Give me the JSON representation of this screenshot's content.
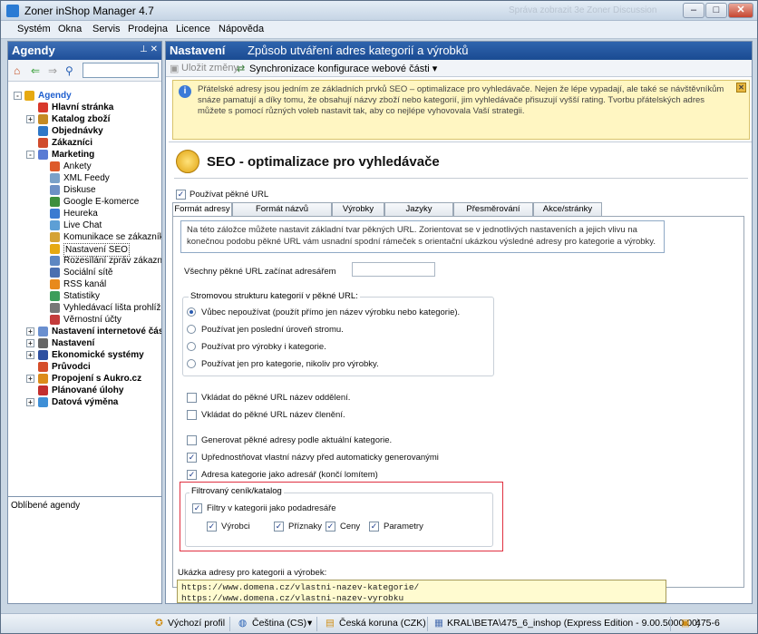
{
  "window": {
    "title": "Zoner inShop Manager 4.7",
    "ghost_text": "Správa zobrazit 3e Zoner Discussion"
  },
  "menu": [
    "Systém",
    "Okna",
    "Servis",
    "Prodejna",
    "Licence",
    "Nápověda"
  ],
  "left_panel": {
    "title": "Agendy",
    "pin_glyphs": "⊥ ✕",
    "search_placeholder": "",
    "tree": [
      {
        "label": "Agendy",
        "bold": true,
        "color": "#1f5fcf",
        "icon_color": "#e6a912",
        "exp": "-"
      },
      {
        "label": "Hlavní stránka",
        "bold": true,
        "icon": "home-icon",
        "icon_color": "#d8382b"
      },
      {
        "label": "Katalog zboží",
        "bold": true,
        "icon_color": "#c58a22",
        "exp": "+"
      },
      {
        "label": "Objednávky",
        "bold": true,
        "icon_color": "#2e77c7"
      },
      {
        "label": "Zákazníci",
        "bold": true,
        "icon_color": "#d04b2c"
      },
      {
        "label": "Marketing",
        "bold": true,
        "icon_color": "#5a7bd4",
        "exp": "-"
      },
      {
        "label": "Ankety",
        "icon_color": "#dd5a2b"
      },
      {
        "label": "XML Feedy",
        "icon_color": "#7aa1c9"
      },
      {
        "label": "Diskuse",
        "icon_color": "#6d90c5"
      },
      {
        "label": "Google E-komerce",
        "icon_color": "#3d8f3d"
      },
      {
        "label": "Heureka",
        "icon_color": "#3b7bd1"
      },
      {
        "label": "Live Chat",
        "icon_color": "#5d9fd5"
      },
      {
        "label": "Komunikace se zákazníkem",
        "icon_color": "#d5a335"
      },
      {
        "label": "Nastavení SEO",
        "icon_color": "#e6a912",
        "selected": true
      },
      {
        "label": "Rozesílání zpráv zákazníkům",
        "icon_color": "#5d87c2"
      },
      {
        "label": "Sociální sítě",
        "icon_color": "#4a6fb0"
      },
      {
        "label": "RSS kanál",
        "icon_color": "#e88a1c"
      },
      {
        "label": "Statistiky",
        "icon_color": "#3c9e5b"
      },
      {
        "label": "Vyhledávací lišta prohlížeče",
        "icon_color": "#777777"
      },
      {
        "label": "Věrnostní účty",
        "icon_color": "#c43c3c"
      },
      {
        "label": "Nastavení internetové části",
        "bold": true,
        "icon_color": "#6a8fcf",
        "exp": "+"
      },
      {
        "label": "Nastavení",
        "bold": true,
        "icon_color": "#666666",
        "exp": "+"
      },
      {
        "label": "Ekonomické systémy",
        "bold": true,
        "icon_color": "#2d4fa0",
        "exp": "+"
      },
      {
        "label": "Průvodci",
        "bold": true,
        "icon_color": "#d54d2a"
      },
      {
        "label": "Propojení s Aukro.cz",
        "bold": true,
        "icon_color": "#dc8c1a",
        "exp": "+"
      },
      {
        "label": "Plánované úlohy",
        "bold": true,
        "icon_color": "#c32e2e"
      },
      {
        "label": "Datová výměna",
        "bold": true,
        "icon_color": "#3f8fd6",
        "exp": "+"
      }
    ],
    "favorites_label": "Oblíbené agendy"
  },
  "right_panel": {
    "section": "Nastavení",
    "subtitle": "Způsob utváření adres kategorií a výrobků",
    "toolbar": {
      "save": "Uložit změny",
      "sync": "Synchronizace konfigurace webové části ▾"
    },
    "info": "Přátelské adresy jsou jedním ze základních prvků SEO – optimalizace pro vyhledávače. Nejen že lépe vypadají, ale také se návštěvníkům snáze pamatují a díky tomu, že obsahují názvy zboží nebo kategorií, jim vyhledávače přisuzují vyšší rating. Tvorbu přátelských adres můžete s pomocí různých voleb nastavit tak, aby co nejlépe vyhovovala Vaší strategii.",
    "seo_title": "SEO - optimalizace pro vyhledávače",
    "use_pretty_url": "Používat pěkné URL",
    "tabs": [
      "Formát adresy",
      "Formát názvů",
      "Výrobky",
      "Jazyky",
      "Přesměrování",
      "Akce/stránky"
    ],
    "tab_info": "Na této záložce můžete nastavit základní tvar pěkných URL. Zorientovat se v jednotlivých nastaveních a jejich vlivu na konečnou podobu pěkné URL vám usnadní spodní rámeček s orientační ukázkou výsledné adresy pro kategorie a výrobky.",
    "prefix_label": "Všechny pěkné URL začínat adresářem",
    "prefix_value": "",
    "tree_group": {
      "title": "Stromovou strukturu kategorií v pěkné URL:",
      "options": [
        {
          "label": "Vůbec nepoužívat (použít přímo jen název výrobku nebo kategorie).",
          "checked": true
        },
        {
          "label": "Používat jen poslední úroveň stromu.",
          "checked": false
        },
        {
          "label": "Používat pro výrobky i kategorie.",
          "checked": false
        },
        {
          "label": "Používat jen pro kategorie, nikoliv pro výrobky.",
          "checked": false
        }
      ]
    },
    "checks": [
      {
        "label": "Vkládat do pěkné URL název oddělení.",
        "checked": false
      },
      {
        "label": "Vkládat do pěkné URL název členění.",
        "checked": false
      },
      {
        "label": "Generovat pěkné adresy podle aktuální kategorie.",
        "checked": false
      },
      {
        "label": "Upřednostňovat vlastní názvy před automaticky generovanými",
        "checked": true
      },
      {
        "label": "Adresa kategorie jako adresář (končí lomítem)",
        "checked": true
      }
    ],
    "filter_group": {
      "title": "Filtrovaný ceník/katalog",
      "main": {
        "label": "Filtry v kategorii jako podadresáře",
        "checked": true
      },
      "subs": [
        {
          "label": "Výrobci",
          "checked": true
        },
        {
          "label": "Příznaky",
          "checked": true
        },
        {
          "label": "Ceny",
          "checked": true
        },
        {
          "label": "Parametry",
          "checked": true
        }
      ]
    },
    "sample": {
      "title": "Ukázka adresy pro kategorii a výrobek:",
      "lines": [
        "https://www.domena.cz/vlastni-nazev-kategorie/",
        "https://www.domena.cz/vlastni-nazev-vyrobku"
      ]
    }
  },
  "status": {
    "profile": "Výchozí profil",
    "language": "Čeština (CS)",
    "currency": "Česká koruna (CZK)",
    "db": "KRAL\\BETA\\475_6_inshop (Express Edition - 9.00.5000.00)",
    "version": "475-6"
  },
  "colors": {
    "accent": "#1f4f99",
    "info_bg": "#fff6c2",
    "highlight_border": "#e03040"
  }
}
